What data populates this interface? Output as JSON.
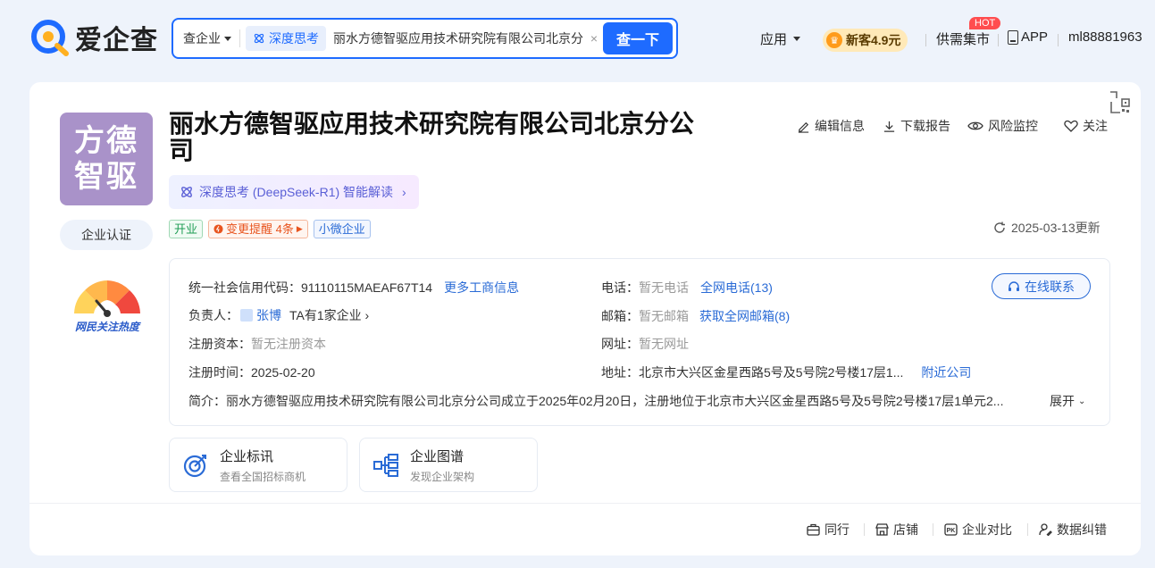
{
  "header": {
    "logo_text": "爱企查",
    "search": {
      "scope": "查企业",
      "deep_chip": "深度思考",
      "query": "丽水方德智驱应用技术研究院有限公司北京分",
      "button": "查一下"
    },
    "nav": {
      "app": "应用",
      "vip": "新客4.9元",
      "market": "供需集市",
      "hot_badge": "HOT",
      "app_download": "APP",
      "user": "ml88881963"
    }
  },
  "company": {
    "logo_line1": "方德",
    "logo_line2": "智驱",
    "name": "丽水方德智驱应用技术研究院有限公司北京分公司",
    "cert_button": "企业认证",
    "gauge_label": "网民关注热度",
    "ai_chip": "深度思考 (DeepSeek-R1) 智能解读",
    "actions": {
      "edit": "编辑信息",
      "download": "下载报告",
      "monitor": "风险监控",
      "follow": "关注"
    },
    "tags": {
      "status": "开业",
      "change": "变更提醒 4条",
      "size": "小微企业"
    },
    "updated": "2025-03-13更新"
  },
  "info": {
    "credit_label": "统一社会信用代码：",
    "credit_value": "91110115MAEAF67T14",
    "more_info": "更多工商信息",
    "person_label": "负责人：",
    "person_name": "张博",
    "person_more": "TA有1家企业",
    "capital_label": "注册资本：",
    "capital_value": "暂无注册资本",
    "date_label": "注册时间：",
    "date_value": "2025-02-20",
    "phone_label": "电话：",
    "phone_value": "暂无电话",
    "phone_link": "全网电话(13)",
    "email_label": "邮箱：",
    "email_value": "暂无邮箱",
    "email_link": "获取全网邮箱(8)",
    "site_label": "网址：",
    "site_value": "暂无网址",
    "addr_label": "地址：",
    "addr_value": "北京市大兴区金星西路5号及5号院2号楼17层1...",
    "addr_link": "附近公司",
    "online_button": "在线联系",
    "intro_label": "简介：",
    "intro_text": "丽水方德智驱应用技术研究院有限公司北京分公司成立于2025年02月20日，注册地位于北京市大兴区金星西路5号及5号院2号楼17层1单元2...",
    "intro_expand": "展开"
  },
  "features": [
    {
      "title": "企业标讯",
      "sub": "查看全国招标商机"
    },
    {
      "title": "企业图谱",
      "sub": "发现企业架构"
    }
  ],
  "bottom": {
    "peer": "同行",
    "shop": "店铺",
    "compare": "企业对比",
    "correct": "数据纠错"
  },
  "colors": {
    "brand": "#1e6bff",
    "logo_bg": "#a992c9",
    "link": "#2a6bd6"
  }
}
